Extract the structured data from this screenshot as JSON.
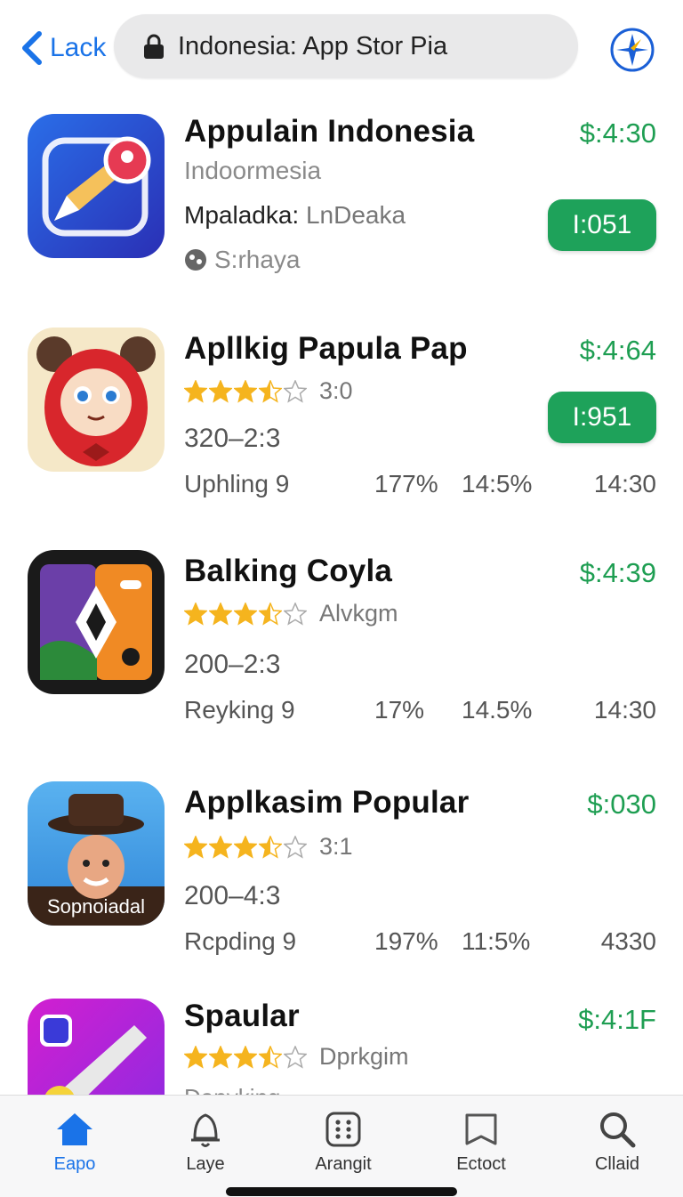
{
  "nav": {
    "back_label": "Lack",
    "url_text": "Indonesia: App Stor Pia",
    "accent": "#1a73e8"
  },
  "apps": [
    {
      "title": "Appulain  Indonesia",
      "price": "$:4:30",
      "subtitle": "Indoormesia",
      "info_bold": "Mpaladka:",
      "info_light": "LnDeaka",
      "developer": "S:rhaya",
      "get_label": "I:051"
    },
    {
      "title": "Apllkig Papula Pap",
      "price": "$:4:64",
      "stars": 3.5,
      "rating": "3:0",
      "get_label": "I:951",
      "range": "320–2:3",
      "stats": [
        "Uphling 9",
        "177%",
        "14:5%",
        "14:30"
      ]
    },
    {
      "title": "Balking Coyla",
      "price": "$:4:39",
      "stars": 3.5,
      "rating": "Alvkgm",
      "range": "200–2:3",
      "stats": [
        "Reyking 9",
        "17%",
        "14.5%",
        "14:30"
      ]
    },
    {
      "title": "Applkasim Popular",
      "price": "$:030",
      "stars": 3.5,
      "rating": "3:1",
      "range": "200–4:3",
      "stats": [
        "Rcpding 9",
        "197%",
        "11:5%",
        "4330"
      ],
      "icon_caption": "Sopnoiadal"
    },
    {
      "title": "Spaular",
      "price": "$:4:1F",
      "stars": 3.5,
      "rating": "Dprkgim",
      "range_partial": "Dapyking"
    }
  ],
  "tabs": [
    {
      "label": "Eapo",
      "icon": "house-icon",
      "active": true
    },
    {
      "label": "Laye",
      "icon": "bell-icon",
      "active": false
    },
    {
      "label": "Arangit",
      "icon": "grid-icon",
      "active": false
    },
    {
      "label": "Ectoct",
      "icon": "bookmark-icon",
      "active": false
    },
    {
      "label": "Cllaid",
      "icon": "search-icon",
      "active": false
    }
  ],
  "colors": {
    "price_green": "#1e9e52",
    "button_green": "#1ea25a",
    "star_gold": "#f5b41e"
  }
}
